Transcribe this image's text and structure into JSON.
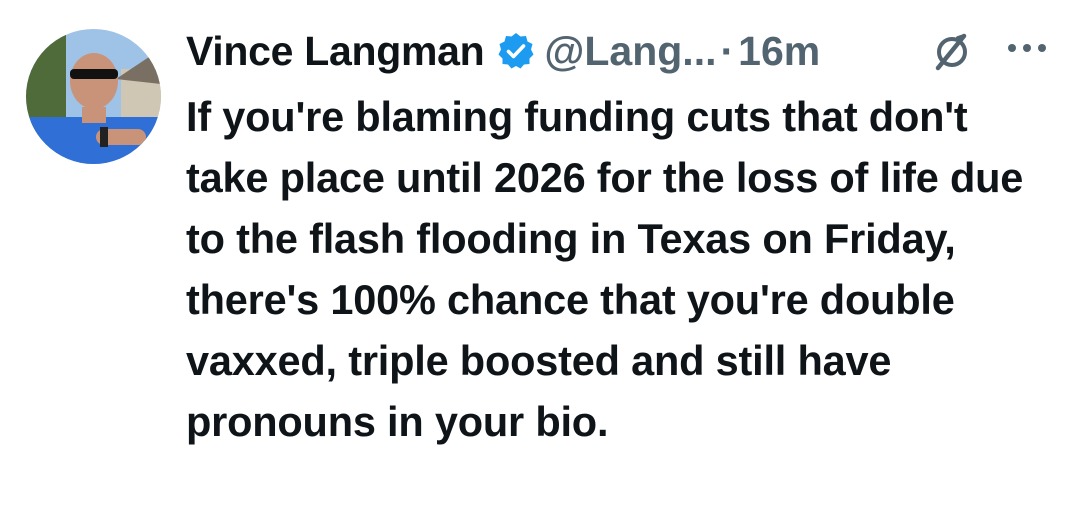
{
  "tweet": {
    "author_name": "Vince Langman",
    "handle": "@Lang...",
    "separator": "·",
    "time": "16m",
    "text": "If you're blaming funding cuts that don't take place until 2026 for the loss of life due to the flash flooding in Texas on Friday, there's 100% chance that you're double vaxxed, triple boosted and still have pronouns in your bio."
  },
  "icons": {
    "verified": "verified-badge-icon",
    "grok": "grok-icon",
    "more": "more-options-icon"
  },
  "colors": {
    "verified_blue": "#1d9bf0",
    "text_primary": "#0f1419",
    "text_secondary": "#536471",
    "background": "#ffffff"
  }
}
